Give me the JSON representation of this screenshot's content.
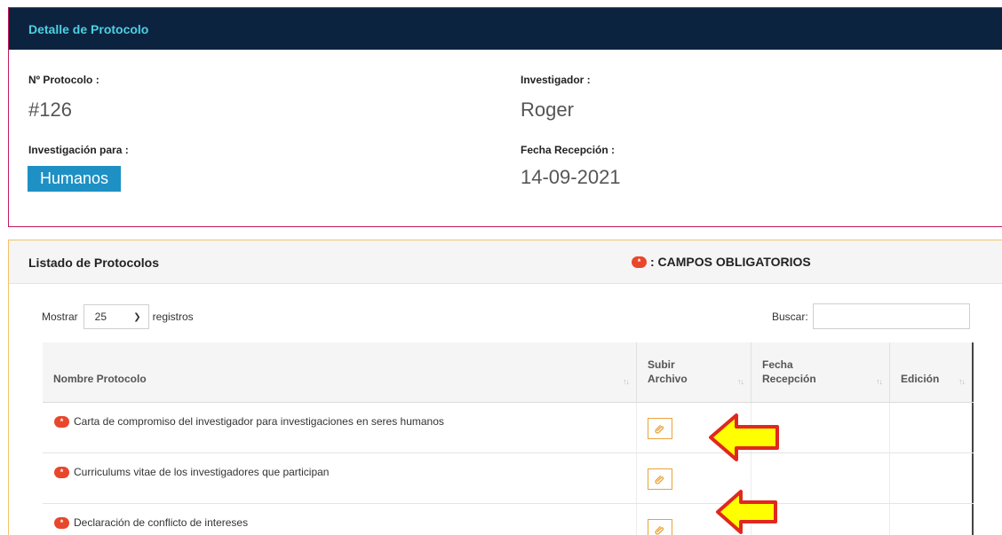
{
  "detail": {
    "title": "Detalle de Protocolo",
    "protocol_label": "Nº Protocolo :",
    "protocol_value": "#126",
    "investigator_label": "Investigador :",
    "investigator_value": "Roger",
    "research_for_label": "Investigación para :",
    "research_for_value": "Humanos",
    "reception_label": "Fecha Recepción :",
    "reception_value": "14-09-2021"
  },
  "list": {
    "title": "Listado de Protocolos",
    "required_legend": ": CAMPOS OBLIGATORIOS",
    "required_marker": "*",
    "show_label": "Mostrar",
    "page_size": "25",
    "records_label": "registros",
    "search_label": "Buscar:",
    "search_value": ""
  },
  "table": {
    "columns": [
      "Nombre Protocolo",
      "Subir Archivo",
      "Fecha Recepción",
      "Edición"
    ],
    "sort_glyph": "↑↓",
    "rows": [
      {
        "name": "Carta de compromiso del investigador para investigaciones en seres humanos",
        "date": "",
        "edit": ""
      },
      {
        "name": "Curriculums vitae de los investigadores que participan",
        "date": "",
        "edit": ""
      },
      {
        "name": "Declaración de conflicto de intereses",
        "date": "",
        "edit": ""
      }
    ]
  },
  "colors": {
    "header_bg": "#0c2340",
    "header_title": "#4dd0e1",
    "badge_bg": "#1e90c4",
    "required_dot": "#e8472c",
    "upload_border": "#e8a33a",
    "arrow_fill": "#ffff00",
    "arrow_stroke": "#e0281f"
  },
  "icons": {
    "upload": "paperclip-icon",
    "arrows": "left-arrow-icon"
  }
}
